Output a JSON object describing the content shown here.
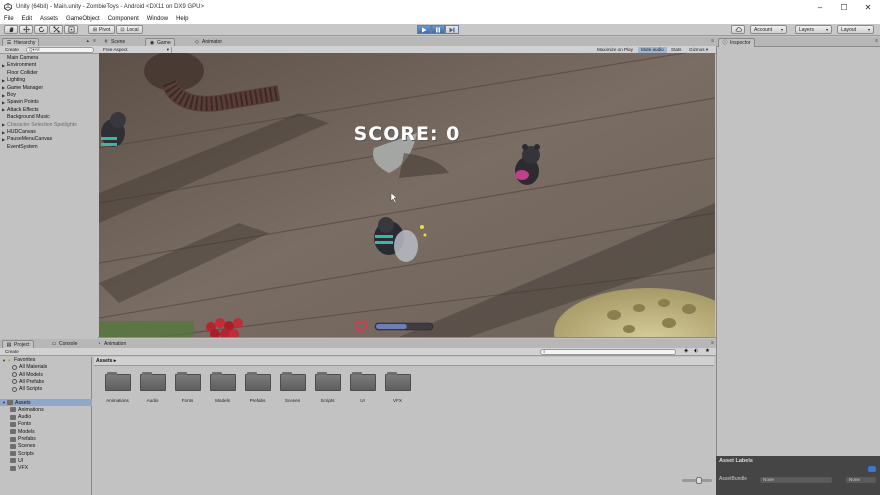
{
  "window": {
    "title": "Unity (64bit) - Main.unity - ZombieToys - Android <DX11 on DX9 GPU>",
    "controls": [
      "–",
      "☐",
      "✕"
    ]
  },
  "menu": [
    "File",
    "Edit",
    "Assets",
    "GameObject",
    "Component",
    "Window",
    "Help"
  ],
  "toolbar": {
    "pivot_label": "Pivot",
    "local_label": "Local",
    "account_label": "Account",
    "layers_label": "Layers",
    "layout_label": "Layout"
  },
  "hierarchy": {
    "tab_label": "Hierarchy",
    "create_label": "Create",
    "search_prefix": "Q▾All",
    "items": [
      {
        "label": "Main Camera",
        "arrow": false,
        "dim": false
      },
      {
        "label": "Environment",
        "arrow": true,
        "dim": false
      },
      {
        "label": "Floor Collider",
        "arrow": false,
        "dim": false
      },
      {
        "label": "Lighting",
        "arrow": true,
        "dim": false
      },
      {
        "label": "Game Manager",
        "arrow": true,
        "dim": false
      },
      {
        "label": "Boy",
        "arrow": true,
        "dim": false
      },
      {
        "label": "Spawn Points",
        "arrow": true,
        "dim": false
      },
      {
        "label": "Attack Effects",
        "arrow": true,
        "dim": false
      },
      {
        "label": "Background Music",
        "arrow": false,
        "dim": false
      },
      {
        "label": "Character Selection Spotlights",
        "arrow": true,
        "dim": true
      },
      {
        "label": "HUDCanvas",
        "arrow": true,
        "dim": false
      },
      {
        "label": "PauseMenuCanvas",
        "arrow": true,
        "dim": false
      },
      {
        "label": "EventSystem",
        "arrow": false,
        "dim": false
      }
    ]
  },
  "center_tabs": [
    {
      "label": "Scene",
      "icon": "scene-icon"
    },
    {
      "label": "Game",
      "icon": "game-icon"
    },
    {
      "label": "Animator",
      "icon": "animator-icon"
    }
  ],
  "game_bar": {
    "aspect": "Free Aspect",
    "toggles": [
      "Maximize on Play",
      "Mute audio",
      "Stats",
      "Gizmos ▾"
    ]
  },
  "game": {
    "score_text": "SCORE: 0",
    "health_fraction": 0.55,
    "colors": {
      "floor": "#6f6257",
      "health_bar": "#6c7fb8",
      "heart": "#e8304a"
    }
  },
  "inspector": {
    "tab_label": "Inspector",
    "asset_labels_title": "Asset Labels",
    "assetbundle_label": "AssetBundle",
    "assetbundle_value": "None",
    "assetbundle_variant": "None"
  },
  "project": {
    "tabs": [
      "Project",
      "Console",
      "Animation"
    ],
    "create_label": "Create",
    "favorites_label": "Favorites",
    "favorites": [
      "All Materials",
      "All Models",
      "All Prefabs",
      "All Scripts"
    ],
    "assets_root": "Assets",
    "asset_folders": [
      "Animations",
      "Audio",
      "Fonts",
      "Models",
      "Prefabs",
      "Scenes",
      "Scripts",
      "UI",
      "VFX"
    ],
    "breadcrumb": "Assets ▸",
    "grid": [
      "Animations",
      "Audio",
      "Fonts",
      "Models",
      "Prefabs",
      "Scenes",
      "Scripts",
      "UI",
      "VFX"
    ]
  }
}
